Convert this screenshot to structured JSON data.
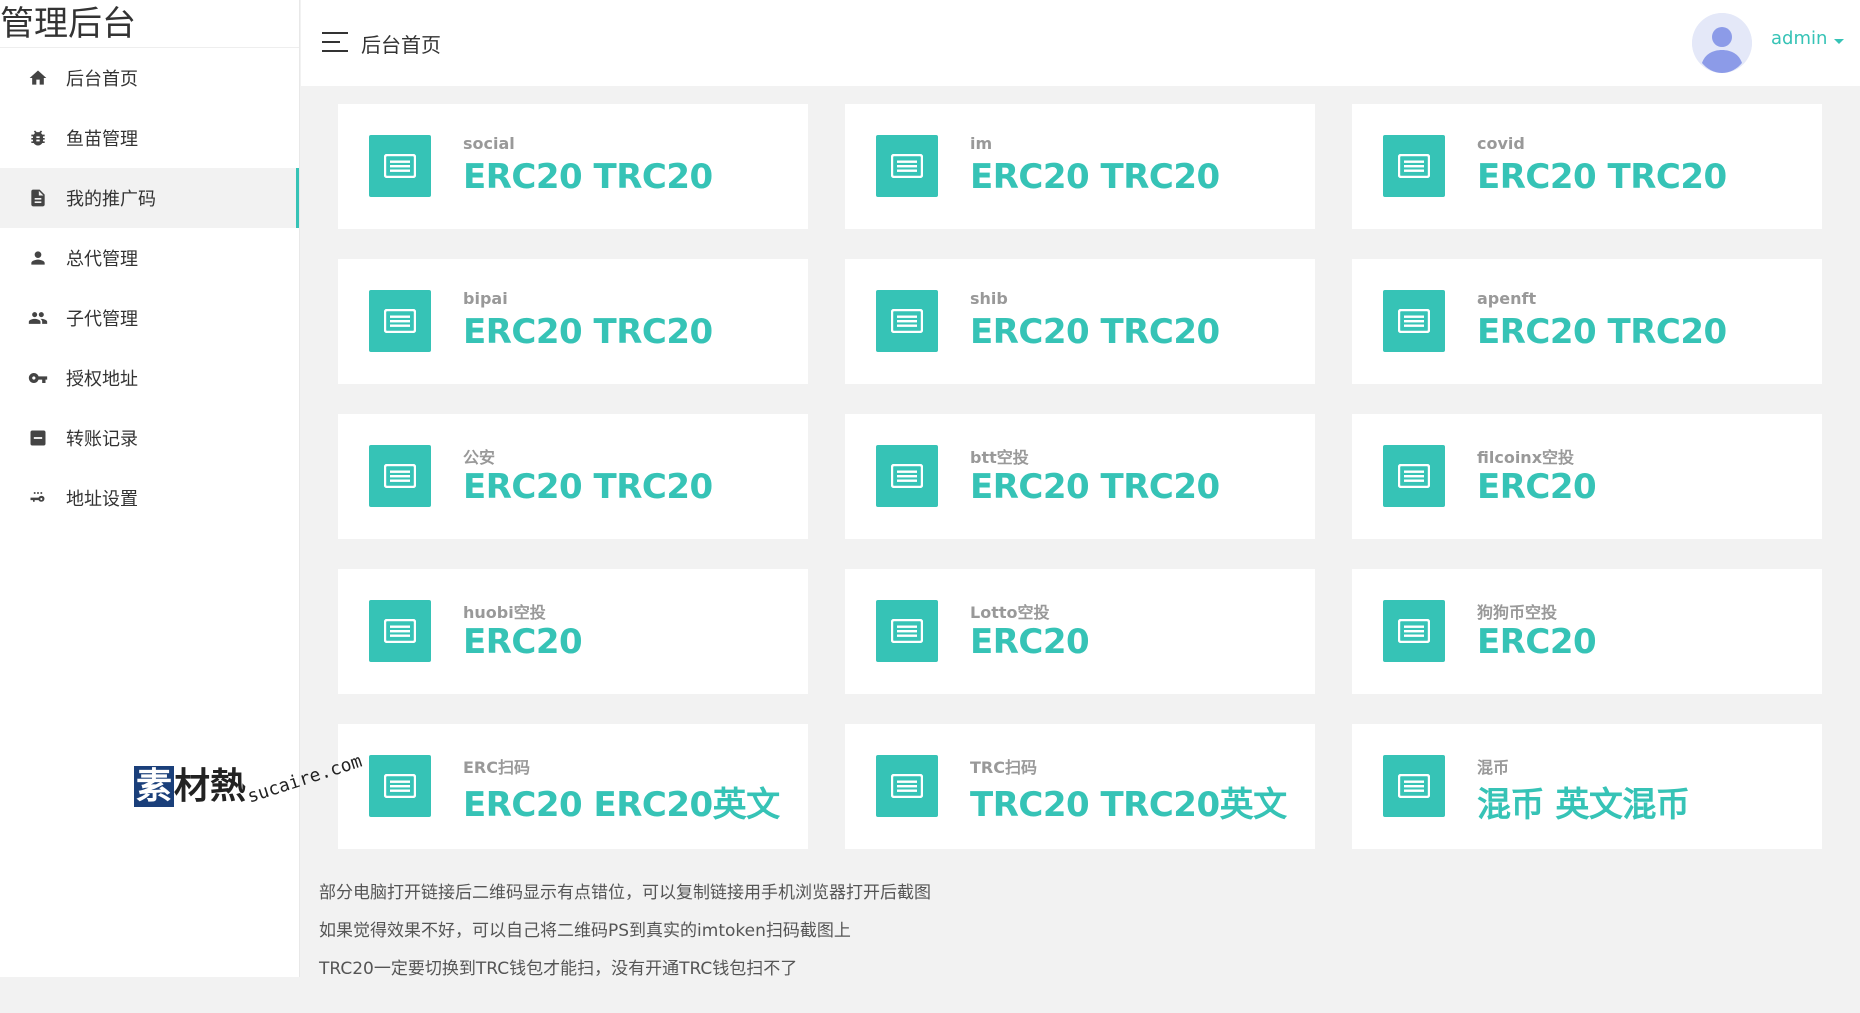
{
  "sidebar": {
    "brand": "管理后台",
    "items": [
      {
        "label": "后台首页",
        "icon": "home-icon"
      },
      {
        "label": "鱼苗管理",
        "icon": "bug-icon"
      },
      {
        "label": "我的推广码",
        "icon": "document-icon"
      },
      {
        "label": "总代管理",
        "icon": "person-icon"
      },
      {
        "label": "子代管理",
        "icon": "people-icon"
      },
      {
        "label": "授权地址",
        "icon": "key-icon"
      },
      {
        "label": "转账记录",
        "icon": "list-box-icon"
      },
      {
        "label": "地址设置",
        "icon": "settings-key-icon"
      }
    ],
    "active_index": 2
  },
  "header": {
    "title": "后台首页",
    "user": "admin"
  },
  "cards": [
    {
      "label": "social",
      "value": "ERC20 TRC20"
    },
    {
      "label": "im",
      "value": "ERC20 TRC20"
    },
    {
      "label": "covid",
      "value": "ERC20 TRC20"
    },
    {
      "label": "bipai",
      "value": "ERC20 TRC20"
    },
    {
      "label": "shib",
      "value": "ERC20 TRC20"
    },
    {
      "label": "apenft",
      "value": "ERC20 TRC20"
    },
    {
      "label": "公安",
      "value": "ERC20 TRC20"
    },
    {
      "label": "btt空投",
      "value": "ERC20 TRC20"
    },
    {
      "label": "filcoinx空投",
      "value": "ERC20"
    },
    {
      "label": "huobi空投",
      "value": "ERC20"
    },
    {
      "label": "Lotto空投",
      "value": "ERC20"
    },
    {
      "label": "狗狗币空投",
      "value": "ERC20"
    },
    {
      "label": "ERC扫码",
      "value": "ERC20 ERC20英文"
    },
    {
      "label": "TRC扫码",
      "value": "TRC20 TRC20英文"
    },
    {
      "label": "混币",
      "value": "混币 英文混币"
    }
  ],
  "notes": [
    "部分电脑打开链接后二维码显示有点错位，可以复制链接用手机浏览器打开后截图",
    "如果觉得效果不好，可以自己将二维码PS到真实的imtoken扫码截图上",
    "TRC20一定要切换到TRC钱包才能扫，没有开通TRC钱包扫不了"
  ],
  "watermark": {
    "first_char": "素",
    "rest": "材熱",
    "site": "sucaire.com"
  },
  "colors": {
    "accent": "#36c3b6",
    "background": "#f2f2f2"
  }
}
